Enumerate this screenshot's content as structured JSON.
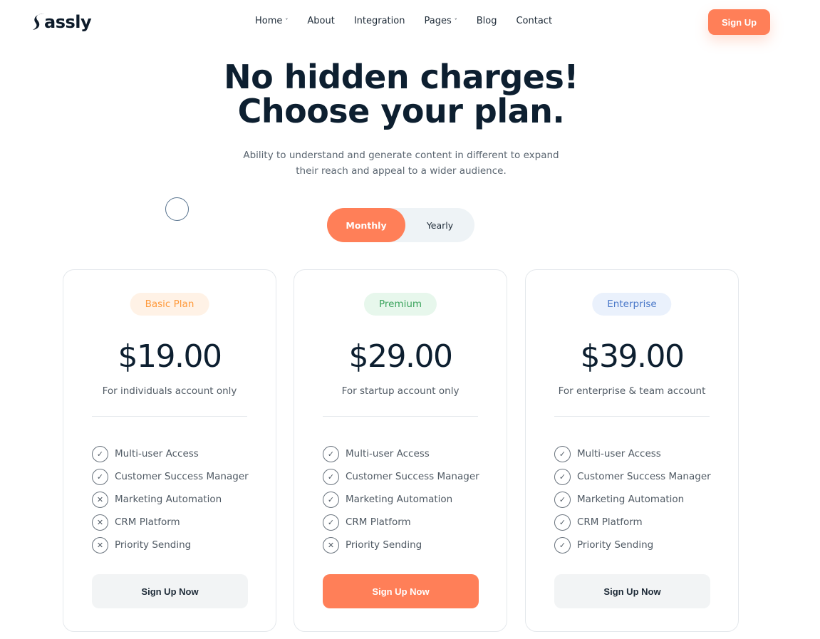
{
  "brand": {
    "name": "assly",
    "logo_icon": "s-swoosh-logo"
  },
  "nav": {
    "items": [
      {
        "label": "Home",
        "has_dropdown": true
      },
      {
        "label": "About",
        "has_dropdown": false
      },
      {
        "label": "Integration",
        "has_dropdown": false
      },
      {
        "label": "Pages",
        "has_dropdown": true
      },
      {
        "label": "Blog",
        "has_dropdown": false
      },
      {
        "label": "Contact",
        "has_dropdown": false
      }
    ],
    "caret": "˅"
  },
  "header": {
    "signup_label": "Sign Up"
  },
  "hero": {
    "title_line1": "No hidden charges!",
    "title_line2": "Choose your plan.",
    "subtitle_line1": "Ability to understand and generate content in different to expand",
    "subtitle_line2": "their reach and appeal to a wider audience."
  },
  "billing_toggle": {
    "monthly": "Monthly",
    "yearly": "Yearly",
    "selected": "Monthly"
  },
  "plans": [
    {
      "badge": "Basic Plan",
      "badge_color": "#ff9a3c",
      "badge_bg": "#fff2e6",
      "price": "$19.00",
      "description": "For individuals account only",
      "features": [
        {
          "label": "Multi-user Access",
          "included": true,
          "icon": "✓"
        },
        {
          "label": "Customer Success Manager",
          "included": true,
          "icon": "✓"
        },
        {
          "label": "Marketing Automation",
          "included": false,
          "icon": "✕"
        },
        {
          "label": "CRM Platform",
          "included": false,
          "icon": "✕"
        },
        {
          "label": "Priority Sending",
          "included": false,
          "icon": "✕"
        }
      ],
      "cta": "Sign Up Now",
      "cta_style": "light"
    },
    {
      "badge": "Premium",
      "badge_color": "#3aa35c",
      "badge_bg": "#e7f7ec",
      "price": "$29.00",
      "description": "For startup account only",
      "features": [
        {
          "label": "Multi-user Access",
          "included": true,
          "icon": "✓"
        },
        {
          "label": "Customer Success Manager",
          "included": true,
          "icon": "✓"
        },
        {
          "label": "Marketing Automation",
          "included": true,
          "icon": "✓"
        },
        {
          "label": "CRM Platform",
          "included": true,
          "icon": "✓"
        },
        {
          "label": "Priority Sending",
          "included": false,
          "icon": "✕"
        }
      ],
      "cta": "Sign Up Now",
      "cta_style": "accent"
    },
    {
      "badge": "Enterprise",
      "badge_color": "#4a78c8",
      "badge_bg": "#eaf1fc",
      "price": "$39.00",
      "description": "For enterprise & team account",
      "features": [
        {
          "label": "Multi-user Access",
          "included": true,
          "icon": "✓"
        },
        {
          "label": "Customer Success Manager",
          "included": true,
          "icon": "✓"
        },
        {
          "label": "Marketing Automation",
          "included": true,
          "icon": "✓"
        },
        {
          "label": "CRM Platform",
          "included": true,
          "icon": "✓"
        },
        {
          "label": "Priority Sending",
          "included": true,
          "icon": "✓"
        }
      ],
      "cta": "Sign Up Now",
      "cta_style": "light"
    }
  ],
  "colors": {
    "accent": "#ff7f58",
    "heading": "#0d1f30",
    "text": "#505a64"
  }
}
